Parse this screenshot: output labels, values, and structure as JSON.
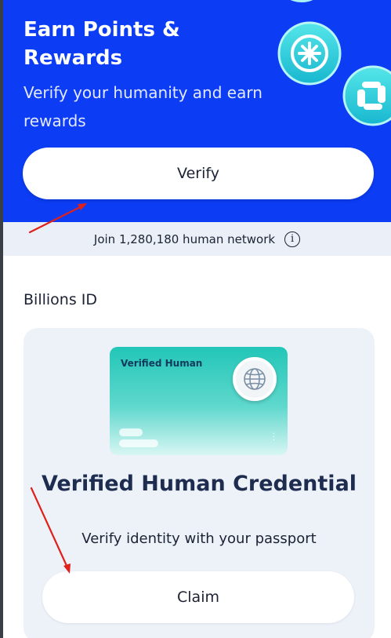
{
  "hero": {
    "title": "Earn Points & Rewards",
    "subtitle": "Verify your humanity and earn rewards",
    "verify_label": "Verify"
  },
  "network": {
    "text": "Join 1,280,180 human network",
    "info_glyph": "i"
  },
  "section": {
    "title": "Billions ID"
  },
  "credential": {
    "card_label": "Verified Human",
    "title": "Verified Human Credential",
    "subtitle": "Verify identity with your passport",
    "claim_label": "Claim"
  },
  "colors": {
    "hero_bg": "#0c3df5",
    "network_bar_bg": "#ebf0f8",
    "card_bg": "#edf2f9",
    "id_card_teal": "#22c6b8",
    "annotation_red": "#e0201a"
  },
  "icons": [
    "asterisk-badge-icon",
    "shield-badge-icon",
    "info-icon",
    "globe-icon"
  ]
}
